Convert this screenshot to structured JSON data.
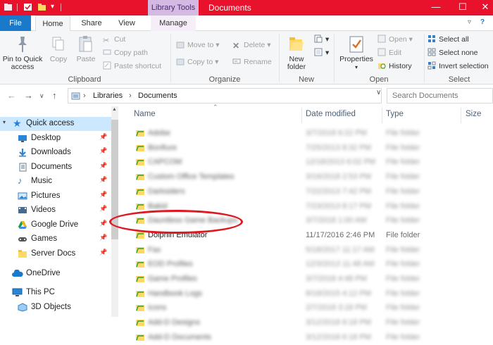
{
  "window": {
    "title": "Documents",
    "context_tab": "Library Tools",
    "controls": [
      "—",
      "☐",
      "✕"
    ],
    "accent": "#e8122d",
    "file_tab_color": "#1979ca"
  },
  "tabs": {
    "file": "File",
    "home": "Home",
    "share": "Share",
    "view": "View",
    "manage": "Manage"
  },
  "ribbon": {
    "clipboard": {
      "label": "Clipboard",
      "pin_label": "Pin to Quick access",
      "copy": "Copy",
      "paste": "Paste",
      "cut": "Cut",
      "copy_path": "Copy path",
      "paste_shortcut": "Paste shortcut"
    },
    "organize": {
      "label": "Organize",
      "move_to": "Move to",
      "copy_to": "Copy to",
      "delete": "Delete",
      "rename": "Rename"
    },
    "new": {
      "label": "New",
      "new_folder": "New folder"
    },
    "open": {
      "label": "Open",
      "properties": "Properties",
      "open": "Open",
      "edit": "Edit",
      "history": "History"
    },
    "select": {
      "label": "Select",
      "select_all": "Select all",
      "select_none": "Select none",
      "invert": "Invert selection"
    }
  },
  "address": {
    "crumbs": [
      "Libraries",
      "Documents"
    ],
    "search_placeholder": "Search Documents"
  },
  "nav": {
    "quick_access": "Quick access",
    "items": [
      {
        "label": "Desktop",
        "icon": "desktop-icon"
      },
      {
        "label": "Downloads",
        "icon": "downloads-icon"
      },
      {
        "label": "Documents",
        "icon": "documents-icon"
      },
      {
        "label": "Music",
        "icon": "music-icon"
      },
      {
        "label": "Pictures",
        "icon": "pictures-icon"
      },
      {
        "label": "Videos",
        "icon": "videos-icon"
      },
      {
        "label": "Google Drive",
        "icon": "google-drive-icon"
      },
      {
        "label": "Games",
        "icon": "games-icon"
      },
      {
        "label": "Server Docs",
        "icon": "folder-icon"
      }
    ],
    "onedrive": "OneDrive",
    "this_pc": "This PC",
    "objects_3d": "3D Objects"
  },
  "columns": {
    "name": "Name",
    "date_modified": "Date modified",
    "type": "Type",
    "size": "Size"
  },
  "files": [
    {
      "name": "Adobe",
      "date": "3/7/2018 6:22 PM",
      "type": "File folder",
      "blurred": true
    },
    {
      "name": "Bonfiure",
      "date": "7/25/2013 8:32 PM",
      "type": "File folder",
      "blurred": true
    },
    {
      "name": "CAPCOM",
      "date": "12/18/2013 6:02 PM",
      "type": "File folder",
      "blurred": true
    },
    {
      "name": "Custom Office Templates",
      "date": "3/19/2018 2:53 PM",
      "type": "File folder",
      "blurred": true
    },
    {
      "name": "Darksiders",
      "date": "7/22/2013 7:42 PM",
      "type": "File folder",
      "blurred": true
    },
    {
      "name": "Bakid",
      "date": "7/23/2013 8:17 PM",
      "type": "File folder",
      "blurred": true
    },
    {
      "name": "Dauntless Game Backups",
      "date": "3/7/2018 1:00 AM",
      "type": "File folder",
      "blurred": true
    },
    {
      "name": "Dolphin Emulator",
      "date": "11/17/2016 2:46 PM",
      "type": "File folder",
      "blurred": false
    },
    {
      "name": "Fax",
      "date": "5/18/2017 11:17 AM",
      "type": "File folder",
      "blurred": true
    },
    {
      "name": "EOD Profiles",
      "date": "12/3/2013 11:48 AM",
      "type": "File folder",
      "blurred": true
    },
    {
      "name": "Game Profiles",
      "date": "3/7/2018 4:48 PM",
      "type": "File folder",
      "blurred": true
    },
    {
      "name": "Handbook Logs",
      "date": "8/19/2015 4:12 PM",
      "type": "File folder",
      "blurred": true
    },
    {
      "name": "Icons",
      "date": "2/7/2018 3:18 PM",
      "type": "File folder",
      "blurred": true
    },
    {
      "name": "Add-D Designs",
      "date": "3/12/2018 6:18 PM",
      "type": "File folder",
      "blurred": true
    },
    {
      "name": "Add-D Documents",
      "date": "3/12/2018 6:18 PM",
      "type": "File folder",
      "blurred": true
    }
  ]
}
